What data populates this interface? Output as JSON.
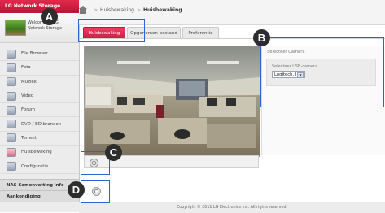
{
  "app": {
    "brand": "LG Network Storage",
    "welcome": "Welcome to LG Network Storage"
  },
  "breadcrumb": {
    "parent": "Huisbewaking",
    "separator": ">",
    "current": "Huisbewaking"
  },
  "tabs": [
    {
      "label": "Huisbewaking",
      "active": true
    },
    {
      "label": "Opgenomen bestand",
      "active": false
    },
    {
      "label": "Preferentie",
      "active": false
    }
  ],
  "sidebar": {
    "items": [
      {
        "label": "File Browser",
        "icon": "file-browser-icon"
      },
      {
        "label": "Foto",
        "icon": "photo-icon"
      },
      {
        "label": "Muziek",
        "icon": "music-icon"
      },
      {
        "label": "Video",
        "icon": "video-icon"
      },
      {
        "label": "Forum",
        "icon": "forum-icon"
      },
      {
        "label": "DVD / BD branden",
        "icon": "disc-icon"
      },
      {
        "label": "Torrent",
        "icon": "torrent-icon"
      },
      {
        "label": "Huisbewaking",
        "icon": "camera-icon"
      },
      {
        "label": "Configuratie",
        "icon": "settings-icon"
      }
    ],
    "summary": "NAS Samenvatting info",
    "notice": "Aankondiging"
  },
  "camera_panel": {
    "title": "Selecteer Camera",
    "usb_label": "Selecteer USB-camera.",
    "selected": "Logitech, Inc."
  },
  "callouts": [
    "A",
    "B",
    "C",
    "D"
  ],
  "footer": "Copyright © 2011 LG Electronics Inc. All rights reserved.",
  "colors": {
    "accent": "#d9204a",
    "callout_border": "#2b63d9"
  }
}
